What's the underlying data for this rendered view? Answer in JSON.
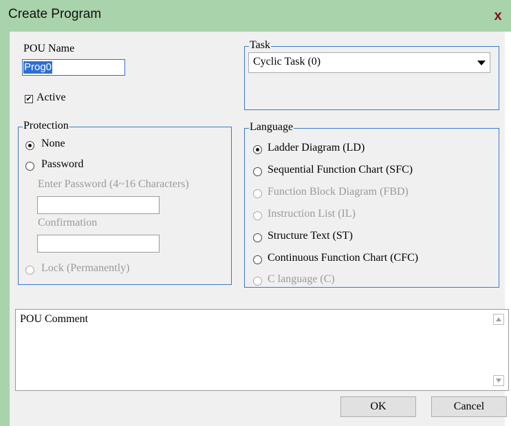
{
  "window": {
    "title": "Create Program",
    "close_label": "x"
  },
  "pou_name": {
    "label": "POU Name",
    "value": "Prog0"
  },
  "active": {
    "label": "Active",
    "checked": true
  },
  "task": {
    "title": "Task",
    "selected": "Cyclic Task (0)"
  },
  "protection": {
    "title": "Protection",
    "options": [
      {
        "label": "None",
        "selected": true,
        "enabled": true
      },
      {
        "label": "Password",
        "selected": false,
        "enabled": true
      },
      {
        "label": "Lock (Permanently)",
        "selected": false,
        "enabled": false
      }
    ],
    "password_label": "Enter Password (4~16 Characters)",
    "confirmation_label": "Confirmation"
  },
  "language": {
    "title": "Language",
    "options": [
      {
        "label": "Ladder Diagram (LD)",
        "selected": true,
        "enabled": true
      },
      {
        "label": "Sequential Function Chart (SFC)",
        "selected": false,
        "enabled": true
      },
      {
        "label": "Function Block Diagram (FBD)",
        "selected": false,
        "enabled": false
      },
      {
        "label": "Instruction List (IL)",
        "selected": false,
        "enabled": false
      },
      {
        "label": "Structure Text (ST)",
        "selected": false,
        "enabled": true
      },
      {
        "label": "Continuous Function Chart (CFC)",
        "selected": false,
        "enabled": true
      },
      {
        "label": "C language (C)",
        "selected": false,
        "enabled": false
      }
    ]
  },
  "comment": {
    "label": "POU Comment"
  },
  "buttons": {
    "ok": "OK",
    "cancel": "Cancel"
  }
}
